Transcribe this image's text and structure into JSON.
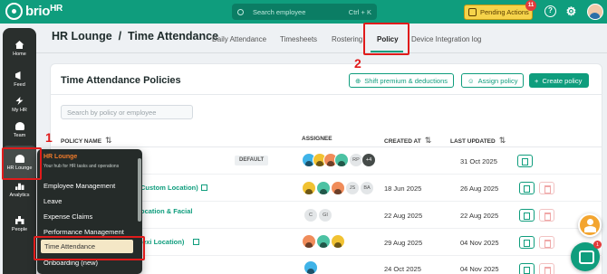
{
  "topbar": {
    "logo_text": "brio",
    "logo_suffix": "HR",
    "search_placeholder": "Search employee",
    "search_shortcut": "Ctrl + K",
    "pending_label": "Pending Actions",
    "pending_count": "11",
    "help_glyph": "?",
    "settings_glyph": "⚙"
  },
  "rail": {
    "items": [
      {
        "label": "Home",
        "icon": "home-icon"
      },
      {
        "label": "Feed",
        "icon": "megaphone-icon"
      },
      {
        "label": "My HR",
        "icon": "bolt-icon"
      },
      {
        "label": "Team",
        "icon": "team-icon"
      },
      {
        "label": "HR Lounge",
        "icon": "people-gear-icon"
      },
      {
        "label": "Analytics",
        "icon": "chart-icon"
      },
      {
        "label": "People",
        "icon": "org-chart-icon"
      }
    ]
  },
  "header": {
    "breadcrumb": "HR Lounge  /  Time Attendance",
    "tabs": [
      {
        "label": "Daily Attendance"
      },
      {
        "label": "Timesheets"
      },
      {
        "label": "Rostering"
      },
      {
        "label": "Policy"
      },
      {
        "label": "Device Integration log"
      }
    ],
    "active_tab": "Policy"
  },
  "card": {
    "title": "Time Attendance Policies",
    "shift_button": "Shift premium & deductions",
    "assign_button": "Assign policy",
    "create_button": "+  Create policy",
    "filter_placeholder": "Search by policy or employee"
  },
  "table": {
    "headers": [
      "POLICY NAME",
      "ASSIGNEE",
      "CREATED AT",
      "LAST UPDATED"
    ],
    "rows": [
      {
        "name": "",
        "default_badge": "DEFAULT",
        "initials": [
          "RP",
          "+4"
        ],
        "created": "",
        "updated": "31 Oct 2025",
        "deletable": false
      },
      {
        "name": "Custom Location)",
        "initials": [
          "JS",
          "BA"
        ],
        "created": "18 Jun 2025",
        "updated": "26 Aug 2025",
        "deletable": true
      },
      {
        "name": "ocation & Facial",
        "initials": [
          "C",
          "GI"
        ],
        "created": "22 Aug 2025",
        "updated": "22 Aug 2025",
        "deletable": true
      },
      {
        "name": "lexi Location)",
        "initials": [],
        "created": "29 Aug 2025",
        "updated": "04 Nov 2025",
        "deletable": true
      },
      {
        "name": "",
        "initials": [],
        "created": "24 Oct 2025",
        "updated": "04 Nov 2025",
        "deletable": true
      }
    ]
  },
  "menu": {
    "title": "HR Lounge",
    "subtitle": "Your hub for HR tasks and operations",
    "items": [
      "Employee Management",
      "Leave",
      "Expense Claims",
      "Performance Management",
      "Time Attendance",
      "Onboarding (new)"
    ],
    "selected": "Time Attendance"
  },
  "annotations": {
    "step1": "1",
    "step2": "2",
    "color": "#e01b1b"
  },
  "colors": {
    "brand": "#0f9d7d",
    "rail": "#2a2f2d",
    "pending": "#f6d34a",
    "accent_orange": "#f07b2a"
  },
  "chat_badge": "1"
}
